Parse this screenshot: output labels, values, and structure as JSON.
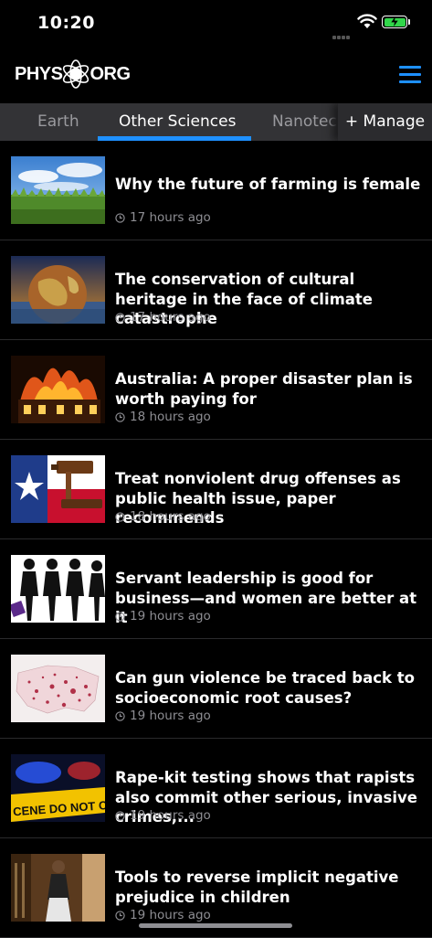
{
  "status": {
    "time": "10:20"
  },
  "header": {
    "logo_left": "PHYS",
    "logo_right": "ORG"
  },
  "tabs": [
    {
      "label": "Earth"
    },
    {
      "label": "Other Sciences"
    },
    {
      "label": "Nanotech"
    }
  ],
  "manage_label": "+ Manage",
  "articles": [
    {
      "title": "Why the future of farming is female",
      "time": "17 hours ago"
    },
    {
      "title": "The conservation of cultural heritage in the face of climate catastrophe",
      "time": "17 hours ago"
    },
    {
      "title": "Australia: A proper disaster plan is worth paying for",
      "time": "18 hours ago"
    },
    {
      "title": "Treat nonviolent drug offenses as public health issue, paper recommends",
      "time": "18 hours ago"
    },
    {
      "title": "Servant leadership is good for business—and women are better at it",
      "time": "19 hours ago"
    },
    {
      "title": "Can gun violence be traced back to socioeconomic root causes?",
      "time": "19 hours ago"
    },
    {
      "title": "Rape-kit testing shows that rapists also commit other serious, invasive crimes,...",
      "time": "19 hours ago"
    },
    {
      "title": "Tools to reverse implicit negative prejudice in children",
      "time": "19 hours ago"
    }
  ],
  "thumb_texts": {
    "crime_tape": "CENE DO NOT C"
  },
  "colors": {
    "accent": "#1e90ff",
    "battery": "#32d74b"
  }
}
